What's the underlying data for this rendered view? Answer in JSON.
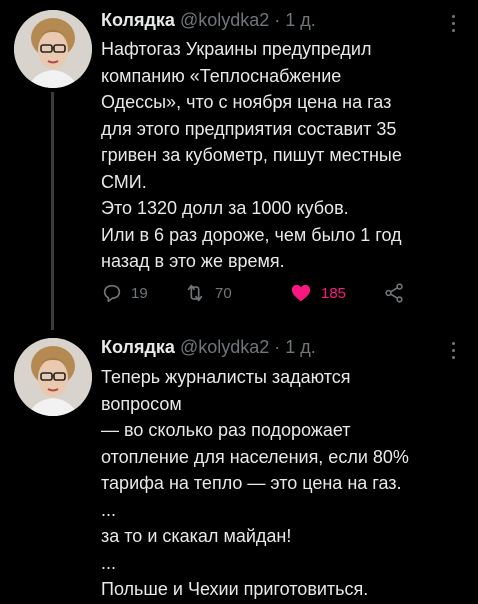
{
  "tweets": [
    {
      "author": "Колядка",
      "handle": "@kolydka2",
      "sep": "·",
      "time": "1 д.",
      "lines": [
        "Нафтогаз Украины предупредил",
        "компанию «Теплоснабжение",
        "Одессы», что с ноября цена на газ",
        "для этого предприятия составит 35",
        "гривен за кубометр, пишут местные",
        "СМИ.",
        "Это 1320 долл за 1000 кубов.",
        "Или в 6 раз дороже, чем было 1 год",
        "назад в это же время."
      ],
      "actions": {
        "replies": "19",
        "retweets": "70",
        "likes": "185"
      }
    },
    {
      "author": "Колядка",
      "handle": "@kolydka2",
      "sep": "·",
      "time": "1 д.",
      "lines": [
        "Теперь журналисты задаются",
        "вопросом",
        "— во сколько раз подорожает",
        "отопление для населения, если 80%",
        "тарифа на тепло — это цена на газ.",
        "...",
        "за то и скакал майдан!",
        "...",
        "Польше и Чехии приготовиться."
      ]
    }
  ],
  "icons": {
    "reply": "reply-icon",
    "retweet": "retweet-icon",
    "like": "heart-icon",
    "share": "share-icon",
    "more": "more-icon"
  },
  "colors": {
    "background": "#000000",
    "text": "#e7e9ea",
    "muted": "#71767b",
    "like": "#f91880"
  }
}
